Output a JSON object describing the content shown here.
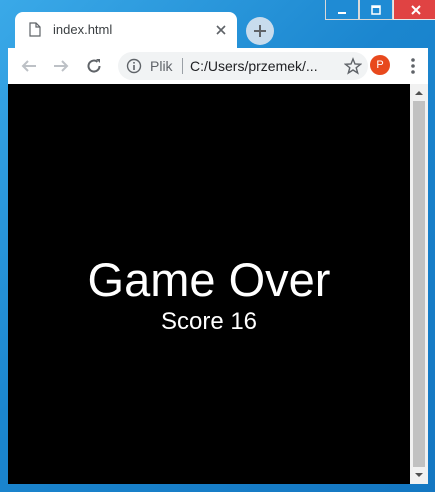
{
  "window": {
    "controls": [
      "minimize",
      "maximize",
      "close"
    ]
  },
  "tab": {
    "title": "index.html",
    "icon": "page-icon"
  },
  "toolbar": {
    "scheme_label": "Plik",
    "url": "C:/Users/przemek/...",
    "avatar_letter": "P"
  },
  "game": {
    "title": "Game Over",
    "score_text": "Score 16"
  },
  "colors": {
    "frame": "#1b86cf",
    "avatar": "#e8491d",
    "game_bg": "#000000",
    "game_text": "#ffffff"
  }
}
